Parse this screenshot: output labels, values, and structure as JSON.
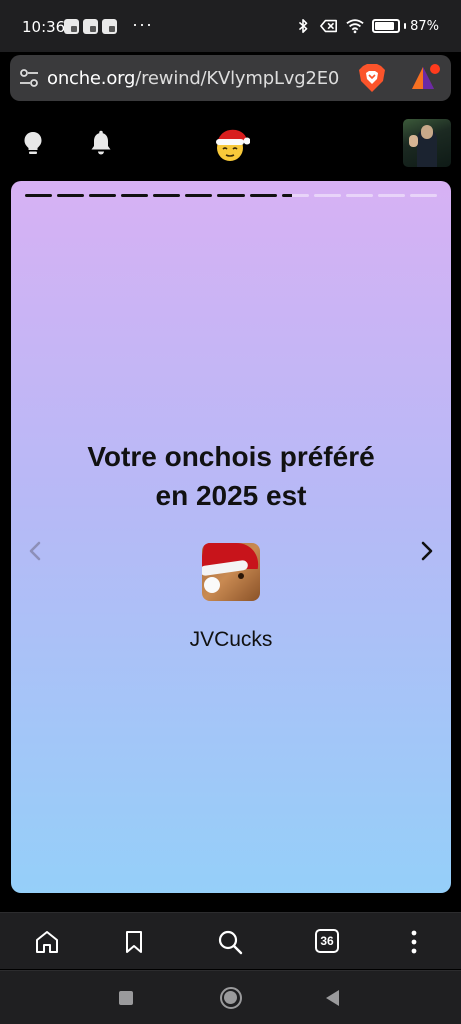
{
  "status_bar": {
    "time": "10:36",
    "more": "···",
    "battery_text": "87%",
    "battery_level": 0.87
  },
  "browser": {
    "url_host": "onche.org",
    "url_path": "/rewind/KVlympLvg2E0",
    "icons": [
      "tune-icon",
      "brave-shield-icon",
      "brave-rewards-icon"
    ],
    "tabs_count": "36"
  },
  "app_header": {
    "icons": [
      "lightbulb-icon",
      "bell-icon",
      "onche-logo-icon",
      "user-avatar"
    ]
  },
  "story": {
    "progress": {
      "segments": 13,
      "completed": 8,
      "current_fraction": 0.4
    },
    "title_line1": "Votre onchois préféré",
    "title_line2": "en 2025 est",
    "favorite_name": "JVCucks"
  },
  "colors": {
    "card_gradient_top": "#d7b1f4",
    "card_gradient_bottom": "#95cff9",
    "text_dark": "#111111",
    "chrome_bg": "#1f1f21"
  }
}
